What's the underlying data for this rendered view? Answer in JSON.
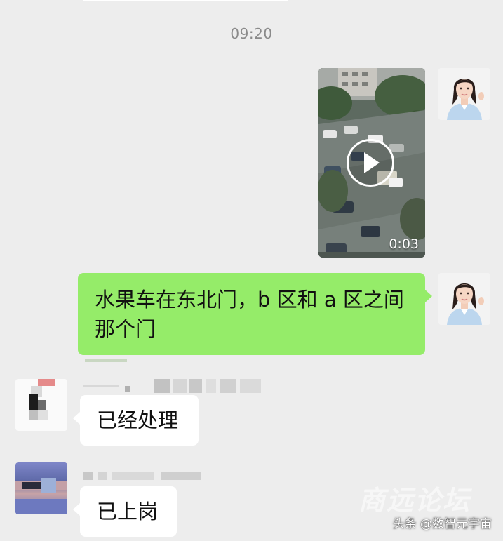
{
  "chat": {
    "timestamp": "09:20",
    "messages": [
      {
        "id": "m1",
        "side": "sent",
        "type": "video",
        "duration": "0:03",
        "play_icon": "play-icon"
      },
      {
        "id": "m2",
        "side": "sent",
        "type": "text",
        "text_line1": "水果车在东北门，b 区和 a 区之间",
        "text_line2": "那个门"
      },
      {
        "id": "m3",
        "side": "received",
        "type": "text",
        "text": "已经处理"
      },
      {
        "id": "m4",
        "side": "received",
        "type": "text",
        "text": "已上岗"
      }
    ]
  },
  "overlay": {
    "watermark": "商远论坛",
    "source_tag": "头条 @数智元宇宙"
  },
  "colors": {
    "background": "#ededed",
    "sent_bubble": "#95ec69",
    "received_bubble": "#ffffff",
    "timestamp_text": "#8a8a8a"
  }
}
